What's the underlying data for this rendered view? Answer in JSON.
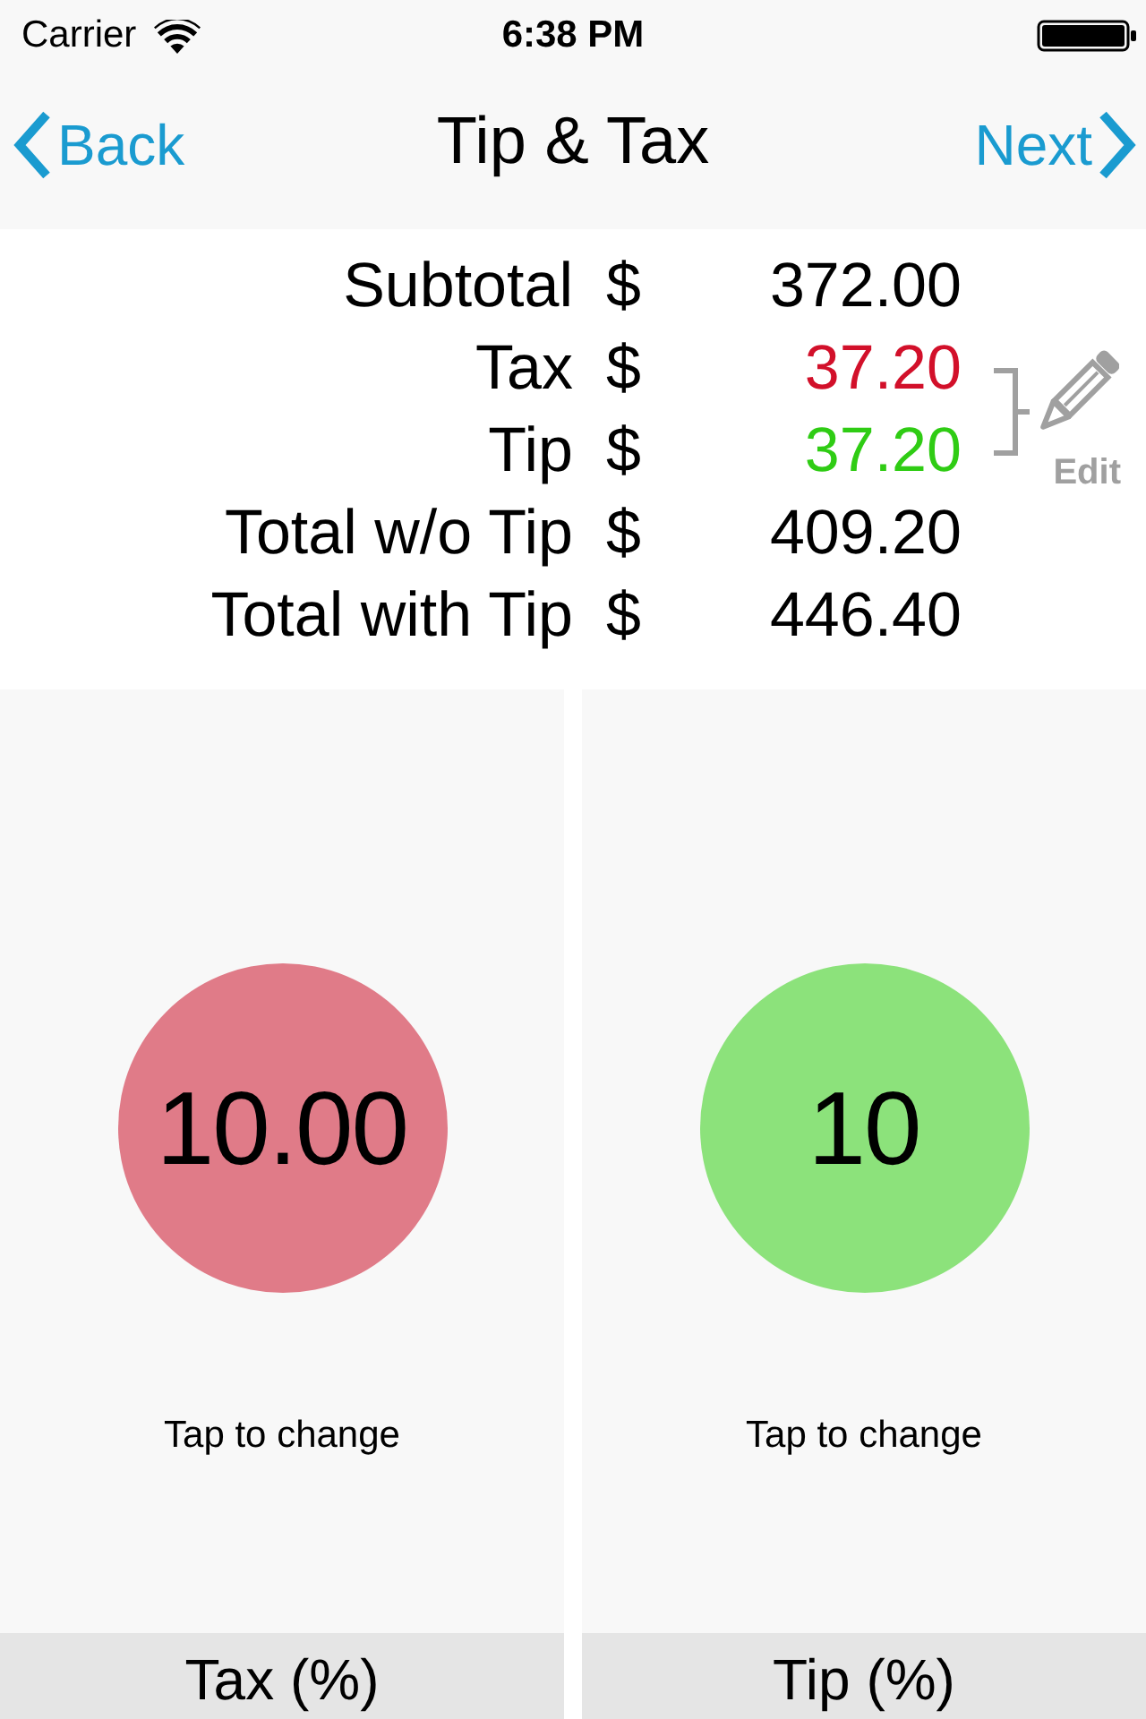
{
  "status_bar": {
    "carrier": "Carrier",
    "time": "6:38 PM"
  },
  "nav": {
    "back": "Back",
    "title": "Tip & Tax",
    "next": "Next"
  },
  "summary": {
    "rows": [
      {
        "label": "Subtotal",
        "currency": "$",
        "value": "372.00",
        "color": "#000000"
      },
      {
        "label": "Tax",
        "currency": "$",
        "value": "37.20",
        "color": "#d2102a"
      },
      {
        "label": "Tip",
        "currency": "$",
        "value": "37.20",
        "color": "#2fcc14"
      },
      {
        "label": "Total w/o Tip",
        "currency": "$",
        "value": "409.20",
        "color": "#000000"
      },
      {
        "label": "Total with Tip",
        "currency": "$",
        "value": "446.40",
        "color": "#000000"
      }
    ],
    "edit": {
      "label": "Edit"
    }
  },
  "panels": [
    {
      "value": "10.00",
      "hint": "Tap to change",
      "title": "Tax (%)",
      "color": "#e07b88"
    },
    {
      "value": "10",
      "hint": "Tap to change",
      "title": "Tip (%)",
      "color": "#8ce27b"
    }
  ]
}
